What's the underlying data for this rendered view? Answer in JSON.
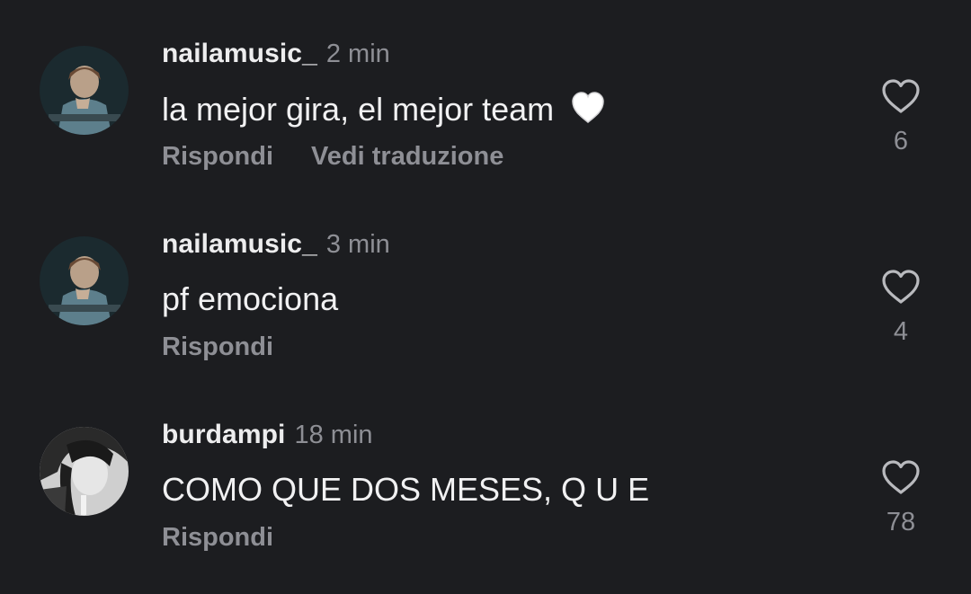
{
  "comments": [
    {
      "username": "nailamusic_",
      "time": "2 min",
      "text": "la mejor gira, el mejor team",
      "emoji": "white-heart-emoji",
      "actions": [
        "Rispondi",
        "Vedi traduzione"
      ],
      "likes": "6"
    },
    {
      "username": "nailamusic_",
      "time": "3 min",
      "text": "pf emociona",
      "actions": [
        "Rispondi"
      ],
      "likes": "4"
    },
    {
      "username": "burdampi",
      "time": "18 min",
      "text": "COMO QUE DOS MESES, Q U E",
      "actions": [
        "Rispondi"
      ],
      "likes": "78"
    }
  ],
  "colors": {
    "background": "#1c1d20",
    "text_primary": "#f1f1f2",
    "text_secondary": "#8e8f95"
  },
  "icons": {
    "like": "heart-outline-icon"
  }
}
